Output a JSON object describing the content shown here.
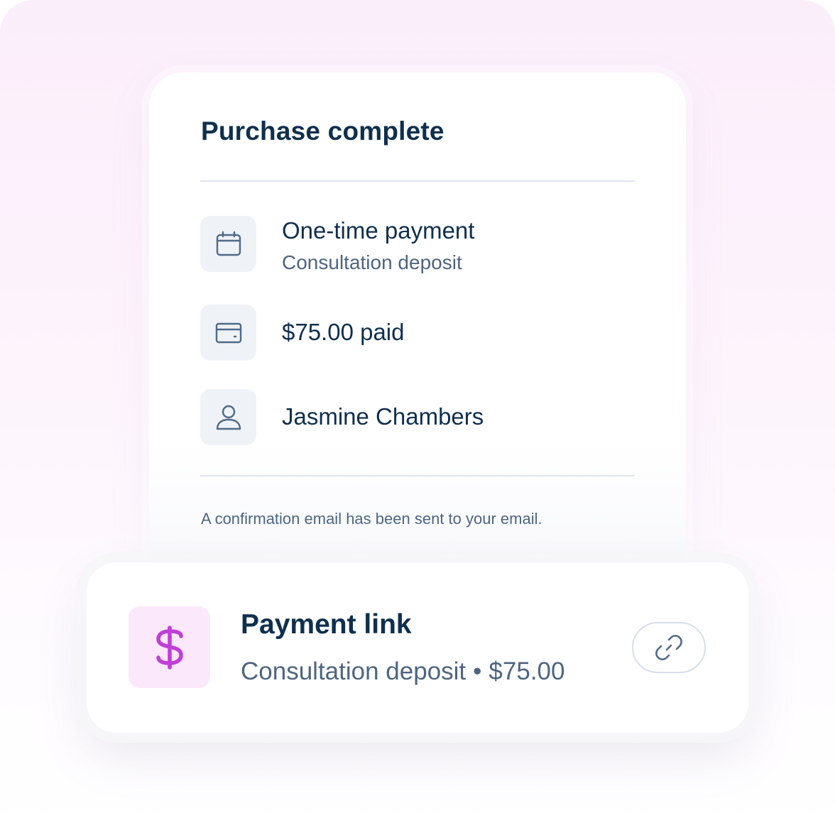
{
  "receipt": {
    "title": "Purchase complete",
    "rows": [
      {
        "icon": "calendar-icon",
        "title": "One-time payment",
        "subtitle": "Consultation deposit"
      },
      {
        "icon": "wallet-icon",
        "title": "$75.00 paid"
      },
      {
        "icon": "user-icon",
        "title": "Jasmine Chambers"
      }
    ],
    "note": "A confirmation email has been sent to your email."
  },
  "payment_link": {
    "icon": "dollar-icon",
    "title": "Payment link",
    "description": "Consultation deposit",
    "separator": "•",
    "amount": "$75.00",
    "action_icon": "link-icon"
  },
  "colors": {
    "text_primary": "#0f2f4e",
    "text_secondary": "#4d6580",
    "accent": "#c03fd6",
    "accent_tile": "#fbe8fb",
    "icon_tile": "#eff2f7",
    "divider": "#dfe5ee"
  }
}
